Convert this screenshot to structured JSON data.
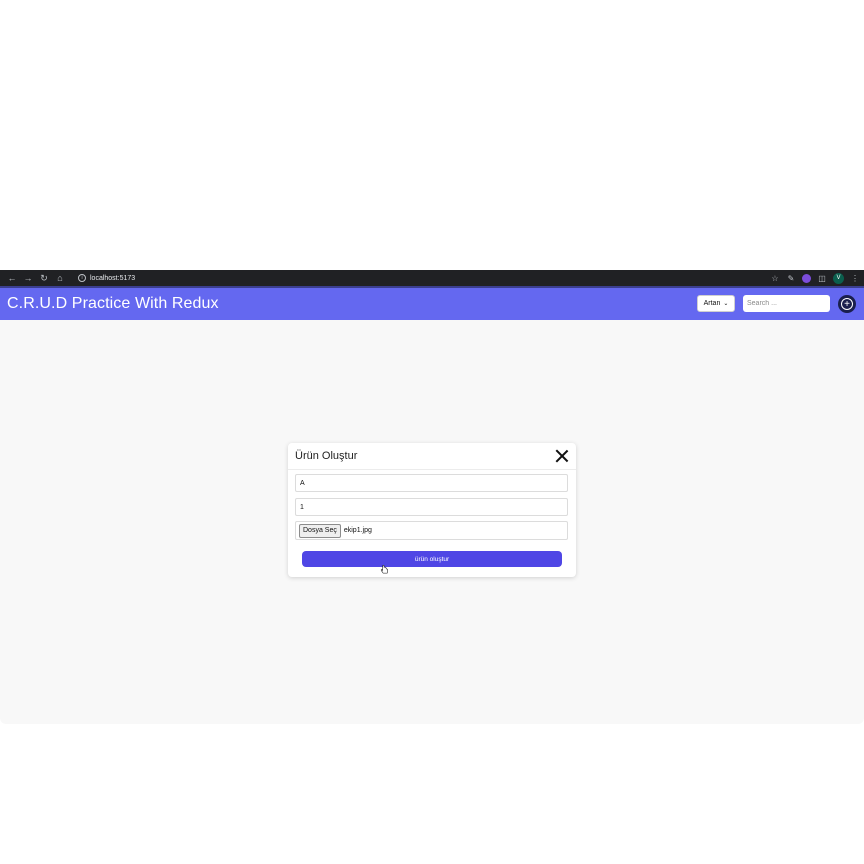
{
  "browser": {
    "url": "localhost:5173",
    "nav_icons": [
      "back-arrow-icon",
      "forward-arrow-icon",
      "reload-icon",
      "home-icon"
    ],
    "profile_initial": "V"
  },
  "header": {
    "title": "C.R.U.D Practice With Redux",
    "sort_select_value": "Artan",
    "search_placeholder": "Search ...",
    "accent_color": "#6468f0"
  },
  "modal": {
    "title": "Ürün Oluştur",
    "name_value": "A",
    "price_value": "1",
    "file_button_label": "Dosya Seç",
    "file_name": "ekip1.jpg",
    "submit_label": "ürün oluştur",
    "submit_color": "#4f46e5"
  }
}
